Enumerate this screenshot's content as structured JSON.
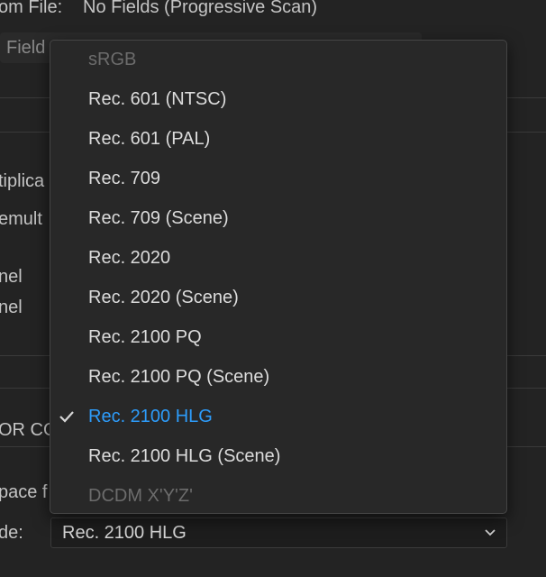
{
  "background": {
    "from_file_label": "om File:",
    "from_file_value": "No Fields (Progressive Scan)",
    "field_label": "Field",
    "multiplicand_label": "tiplica",
    "premultiplied_label": "emult",
    "channel_label_1": "nel",
    "channel_label_2": "nel",
    "color_section_label": "OR CO",
    "space_label": "pace f",
    "override_label": "de:"
  },
  "footer_select": {
    "value": "Rec. 2100 HLG"
  },
  "menu": {
    "items": [
      {
        "label": "sRGB",
        "disabled": true,
        "selected": false
      },
      {
        "label": "Rec. 601 (NTSC)",
        "disabled": false,
        "selected": false
      },
      {
        "label": "Rec. 601 (PAL)",
        "disabled": false,
        "selected": false
      },
      {
        "label": "Rec. 709",
        "disabled": false,
        "selected": false
      },
      {
        "label": "Rec. 709 (Scene)",
        "disabled": false,
        "selected": false
      },
      {
        "label": "Rec. 2020",
        "disabled": false,
        "selected": false
      },
      {
        "label": "Rec. 2020 (Scene)",
        "disabled": false,
        "selected": false
      },
      {
        "label": "Rec. 2100 PQ",
        "disabled": false,
        "selected": false
      },
      {
        "label": "Rec. 2100 PQ (Scene)",
        "disabled": false,
        "selected": false
      },
      {
        "label": "Rec. 2100 HLG",
        "disabled": false,
        "selected": true
      },
      {
        "label": "Rec. 2100 HLG (Scene)",
        "disabled": false,
        "selected": false
      },
      {
        "label": "DCDM X'Y'Z'",
        "disabled": true,
        "selected": false
      }
    ]
  },
  "colors": {
    "accent": "#2d9cfa",
    "menu_bg": "#282828",
    "panel_bg": "#232323"
  },
  "icons": {
    "selected_marker": "checkmark-icon",
    "dropdown": "chevron-down-icon"
  }
}
